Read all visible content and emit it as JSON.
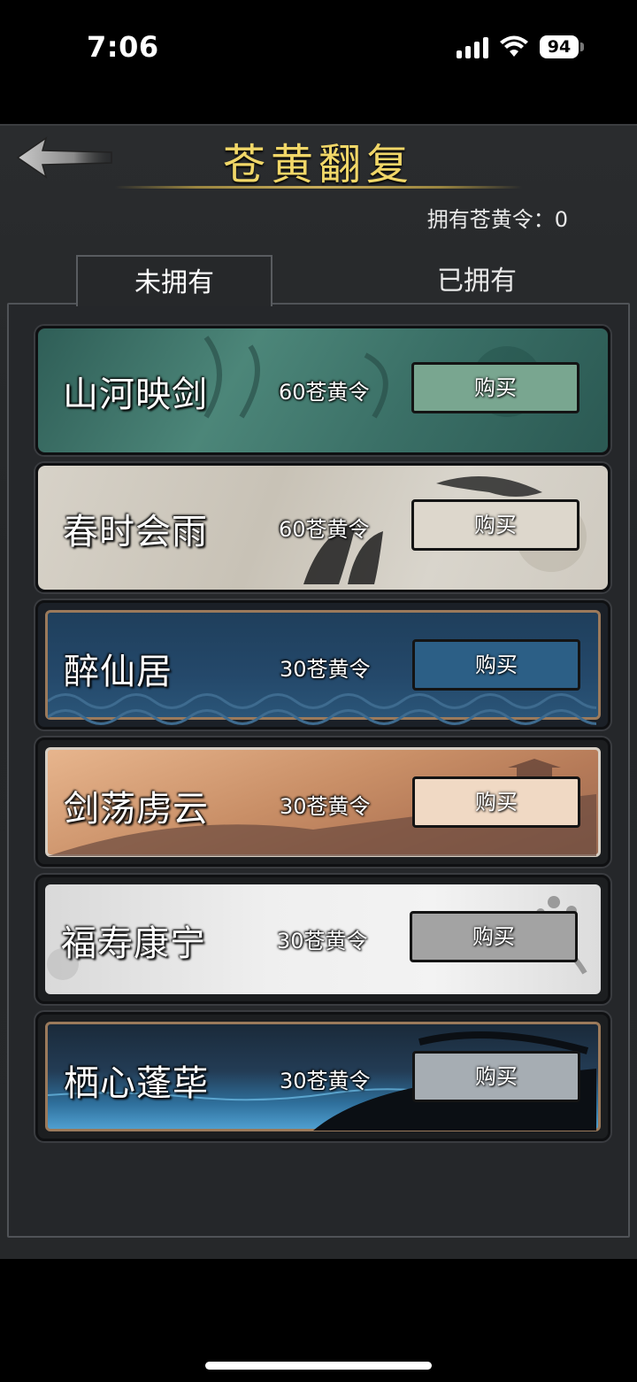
{
  "status_bar": {
    "time": "7:06",
    "battery": "94"
  },
  "header": {
    "title": "苍黄翻复",
    "owned_label": "拥有苍黄令：",
    "owned_value": "0"
  },
  "tabs": [
    {
      "label": "未拥有",
      "active": true
    },
    {
      "label": "已拥有",
      "active": false
    }
  ],
  "items": [
    {
      "name": "山河映剑",
      "price": "60苍黄令",
      "buy_label": "购买"
    },
    {
      "name": "春时会雨",
      "price": "60苍黄令",
      "buy_label": "购买"
    },
    {
      "name": "醉仙居",
      "price": "30苍黄令",
      "buy_label": "购买"
    },
    {
      "name": "剑荡虏云",
      "price": "30苍黄令",
      "buy_label": "购买"
    },
    {
      "name": "福寿康宁",
      "price": "30苍黄令",
      "buy_label": "购买"
    },
    {
      "name": "栖心蓬荜",
      "price": "30苍黄令",
      "buy_label": "购买"
    }
  ],
  "icons": {
    "back": "arrow-left-icon",
    "signal": "cellular-signal-icon",
    "wifi": "wifi-icon",
    "battery": "battery-icon"
  },
  "colors": {
    "title_gold": "#f1d768",
    "panel_bg": "#26282a"
  }
}
